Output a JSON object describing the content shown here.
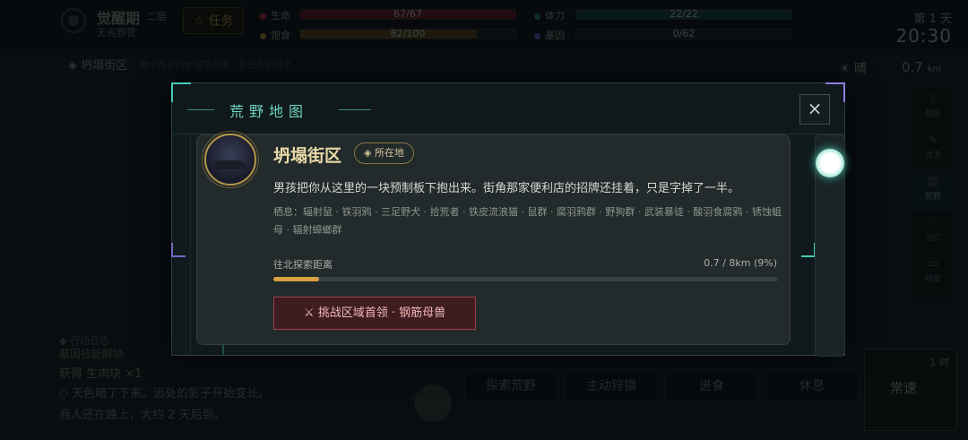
{
  "header": {
    "stage": "觉醒期",
    "floor": "二层",
    "location_sub": "无名野营",
    "task_label": "任务",
    "task_icon": "star-icon",
    "stats": [
      {
        "label": "生命",
        "value": "67/67",
        "fill": 1.0,
        "color": "#c0343c"
      },
      {
        "label": "饱食",
        "value": "82/100",
        "fill": 0.82,
        "color": "#b58a2e"
      },
      {
        "label": "体力",
        "value": "22/22",
        "fill": 1.0,
        "color": "#2b8a7a"
      },
      {
        "label": "基因",
        "value": "0/62",
        "fill": 0.0,
        "color": "#6a58c0"
      }
    ],
    "day": "第 1 天",
    "time": "20:30"
  },
  "location_bar": {
    "name": "坍塌街区",
    "tip": "南水在右的水塔等你是，会出去的这个。",
    "weather": "晴",
    "distance": "0.7",
    "distance_unit": "km"
  },
  "side_nav": [
    {
      "label": "基因",
      "icon": "dna-icon"
    },
    {
      "label": "改造",
      "icon": "pencil-icon"
    },
    {
      "label": "荒野",
      "icon": "map-icon"
    },
    {
      "label": "记忆",
      "icon": "heart-icon"
    },
    {
      "label": "档案",
      "icon": "folder-icon"
    },
    {
      "label": "系统",
      "icon": "gear-icon"
    }
  ],
  "log": {
    "title": "行动日志",
    "lines": [
      "基因技能解锁",
      "获得 生肉块 ×1",
      "◇ 天色暗了下来。远处的影子开始变长。",
      "商人还在路上，大约 2 天后到。"
    ]
  },
  "actions": [
    "探索荒野",
    "主动狩猎",
    "进食",
    "休息"
  ],
  "speed": {
    "hour": "1 时",
    "label": "常速"
  },
  "modal": {
    "title": "荒野地图",
    "close": "×",
    "area": {
      "name": "坍塌街区",
      "badge": "所在地",
      "description": "男孩把你从这里的一块预制板下抱出来。街角那家便利店的招牌还挂着，只是字掉了一半。",
      "habitat": "栖息：辐射鼠 · 铁羽鸦 · 三足野犬 · 拾荒者 · 铁皮流浪猫 · 鼠群 · 腐羽鸦群 · 野狗群 · 武装暴徒 · 酸羽食腐鸦 · 锈蚀蛆母 · 辐射蟑螂群",
      "progress_label": "往北探索距离",
      "progress_value": "0.7 / 8km (9%)",
      "progress": 0.09,
      "boss_button": "⚔ 挑战区域首领 · 钢筋母兽"
    }
  }
}
